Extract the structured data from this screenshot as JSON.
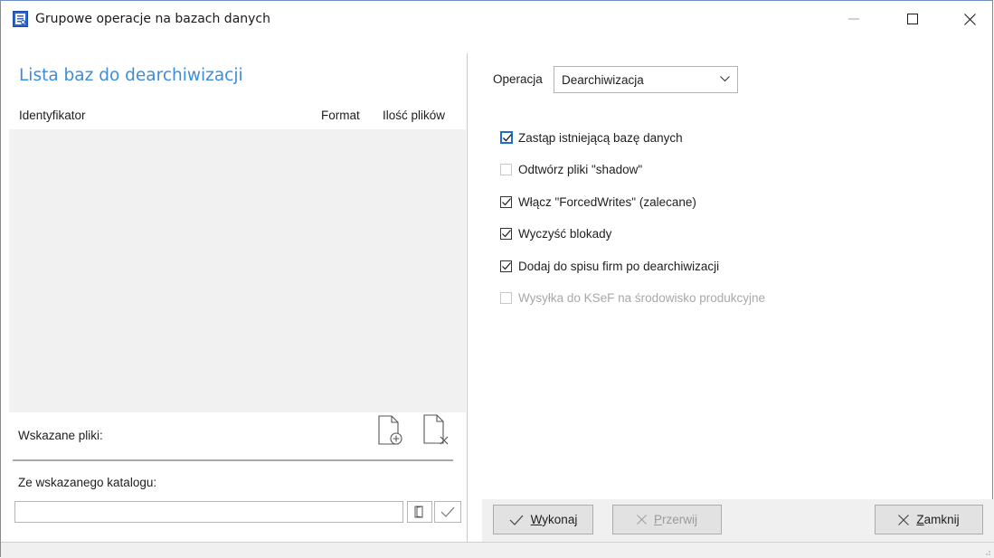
{
  "window": {
    "title": "Grupowe operacje na bazach danych"
  },
  "left_panel": {
    "list_title": "Lista baz do dearchiwizacji",
    "columns": [
      "Identyfikator",
      "Format",
      "Ilość plików"
    ],
    "rows": [],
    "selected_files_label": "Wskazane pliki:",
    "directory_label": "Ze wskazanego katalogu:",
    "directory_value": ""
  },
  "right_panel": {
    "operation_label": "Operacja",
    "operation_value": "Dearchiwizacja",
    "options": [
      {
        "label": "Zastąp istniejącą bazę danych",
        "checked": true,
        "enabled": true
      },
      {
        "label": "Odtwórz pliki \"shadow\"",
        "checked": false,
        "enabled": true
      },
      {
        "label": "Włącz \"ForcedWrites\" (zalecane)",
        "checked": true,
        "enabled": true
      },
      {
        "label": "Wyczyść blokady",
        "checked": true,
        "enabled": true
      },
      {
        "label": "Dodaj do spisu firm po dearchiwizacji",
        "checked": true,
        "enabled": true
      },
      {
        "label": "Wysyłka do KSeF na środowisko produkcyjne",
        "checked": false,
        "enabled": false
      }
    ]
  },
  "buttons": {
    "run_prefix": "W",
    "run_rest": "ykonaj",
    "stop_prefix": "P",
    "stop_rest": "rzerwij",
    "close_prefix": "Z",
    "close_rest": "amknij"
  },
  "colors": {
    "accent": "#3c8ddb",
    "list_bg": "#f1f1f1",
    "button_bg": "#e2e2e2",
    "disabled_text": "#a8a8a8"
  }
}
